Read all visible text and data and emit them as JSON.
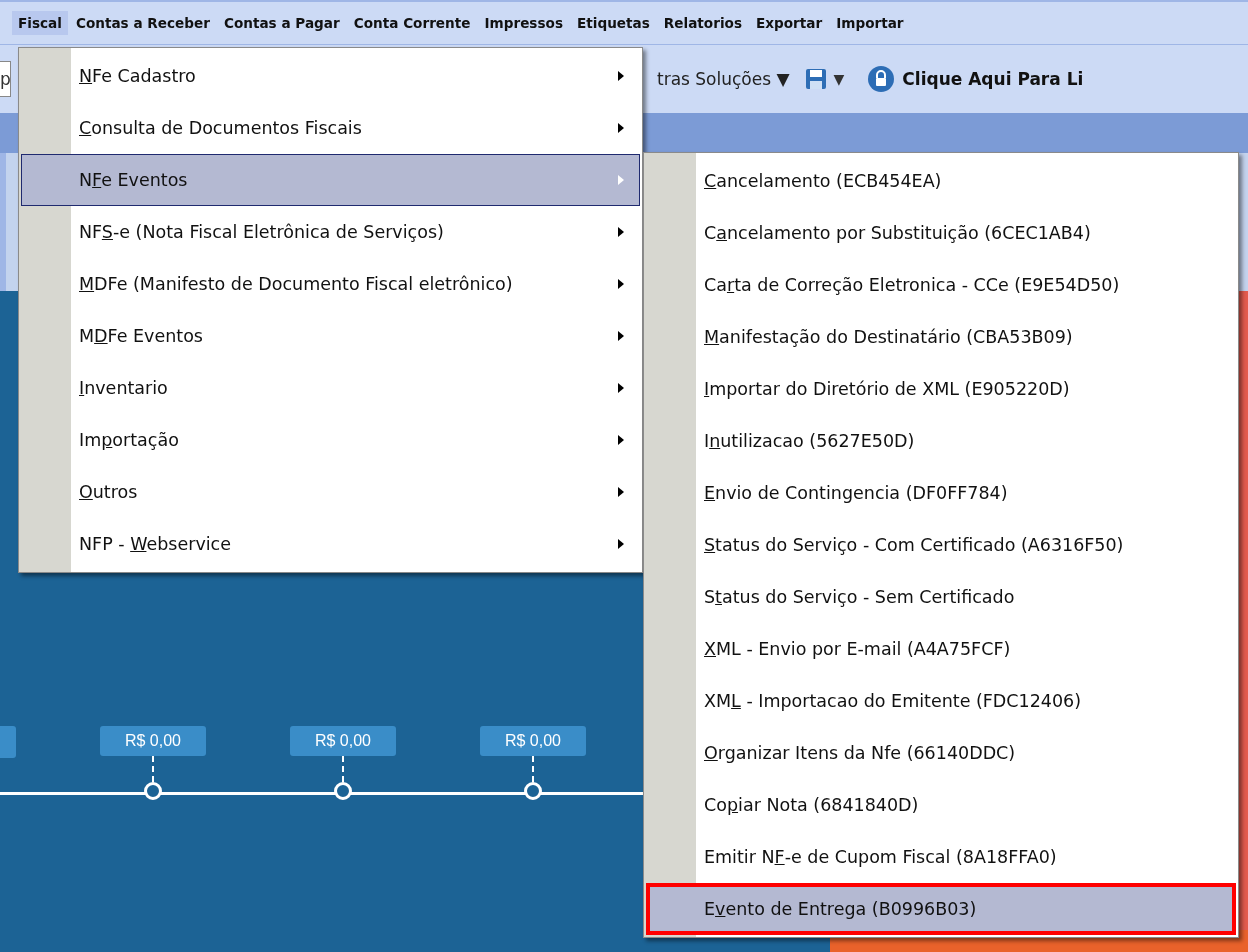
{
  "menubar": [
    {
      "label": "Fiscal",
      "selected": true
    },
    {
      "label": "Contas a Receber",
      "selected": false
    },
    {
      "label": "Contas a Pagar",
      "selected": false
    },
    {
      "label": "Conta Corrente",
      "selected": false
    },
    {
      "label": "Impressos",
      "selected": false
    },
    {
      "label": "Etiquetas",
      "selected": false
    },
    {
      "label": "Relatorios",
      "selected": false
    },
    {
      "label": "Exportar",
      "selected": false
    },
    {
      "label": "Importar",
      "selected": false
    }
  ],
  "toolbar": {
    "field_value": "p",
    "solutions_label": "tras Soluções ▼",
    "save_dropdown": "▼",
    "unlock_label": "Clique Aqui Para Li"
  },
  "timeline": {
    "badges": [
      "R$ 0,00",
      "R$ 0,00",
      "R$ 0,00"
    ]
  },
  "menu": {
    "items": [
      {
        "label_parts": {
          "key": "N",
          "post": "Fe Cadastro"
        },
        "selected": false
      },
      {
        "label_parts": {
          "key": "C",
          "post": "onsulta de Documentos Fiscais"
        },
        "selected": false
      },
      {
        "label_parts": {
          "pre": "N",
          "key": "F",
          "post": "e Eventos"
        },
        "selected": true
      },
      {
        "label_parts": {
          "pre": "NF",
          "key": "S",
          "post": "-e (Nota Fiscal Eletrônica de Serviços)"
        },
        "selected": false
      },
      {
        "label_parts": {
          "key": "M",
          "post": "DFe (Manifesto de Documento Fiscal eletrônico)"
        },
        "selected": false
      },
      {
        "label_parts": {
          "pre": "M",
          "key": "D",
          "post": "Fe Eventos"
        },
        "selected": false
      },
      {
        "label_parts": {
          "key": "I",
          "post": "nventario"
        },
        "selected": false
      },
      {
        "label_parts": {
          "pre": "Im",
          "key": "p",
          "post": "ortação"
        },
        "selected": false
      },
      {
        "label_parts": {
          "key": "O",
          "post": "utros"
        },
        "selected": false
      },
      {
        "label_parts": {
          "pre": "NFP - ",
          "key": "W",
          "post": "ebservice"
        },
        "selected": false
      }
    ]
  },
  "submenu": {
    "items": [
      {
        "label_parts": {
          "key": "C",
          "post": "ancelamento (ECB454EA)"
        },
        "selected": false
      },
      {
        "label_parts": {
          "pre": "C",
          "key": "a",
          "post": "ncelamento por Substituição (6CEC1AB4)"
        },
        "selected": false
      },
      {
        "label_parts": {
          "pre": "Ca",
          "key": "r",
          "post": "ta de Correção Eletronica - CCe (E9E54D50)"
        },
        "selected": false
      },
      {
        "label_parts": {
          "key": "M",
          "post": "anifestação do Destinatário (CBA53B09)"
        },
        "selected": false
      },
      {
        "label_parts": {
          "key": "I",
          "post": "mportar do Diretório de XML (E905220D)"
        },
        "selected": false
      },
      {
        "label_parts": {
          "pre": "I",
          "key": "n",
          "post": "utilizacao (5627E50D)"
        },
        "selected": false
      },
      {
        "label_parts": {
          "key": "E",
          "post": "nvio de Contingencia (DF0FF784)"
        },
        "selected": false
      },
      {
        "label_parts": {
          "key": "S",
          "post": "tatus do Serviço - Com Certificado (A6316F50)"
        },
        "selected": false
      },
      {
        "label_parts": {
          "pre": "S",
          "key": "t",
          "post": "atus do Serviço - Sem Certificado"
        },
        "selected": false
      },
      {
        "label_parts": {
          "key": "X",
          "post": "ML - Envio por E-mail (A4A75FCF)"
        },
        "selected": false
      },
      {
        "label_parts": {
          "pre": "XM",
          "key": "L",
          "post": " - Importacao do Emitente (FDC12406)"
        },
        "selected": false
      },
      {
        "label_parts": {
          "key": "O",
          "post": "rganizar Itens da Nfe (66140DDC)"
        },
        "selected": false
      },
      {
        "label_parts": {
          "pre": "Co",
          "key": "p",
          "post": "iar Nota (6841840D)"
        },
        "selected": false
      },
      {
        "label_parts": {
          "pre": "Emitir N",
          "key": "F",
          "post": "-e de Cupom Fiscal (8A18FFA0)"
        },
        "selected": false
      },
      {
        "label_parts": {
          "pre": "E",
          "key": "v",
          "post": "ento de Entrega (B0996B03)"
        },
        "selected": true,
        "highlighted": true
      }
    ]
  }
}
